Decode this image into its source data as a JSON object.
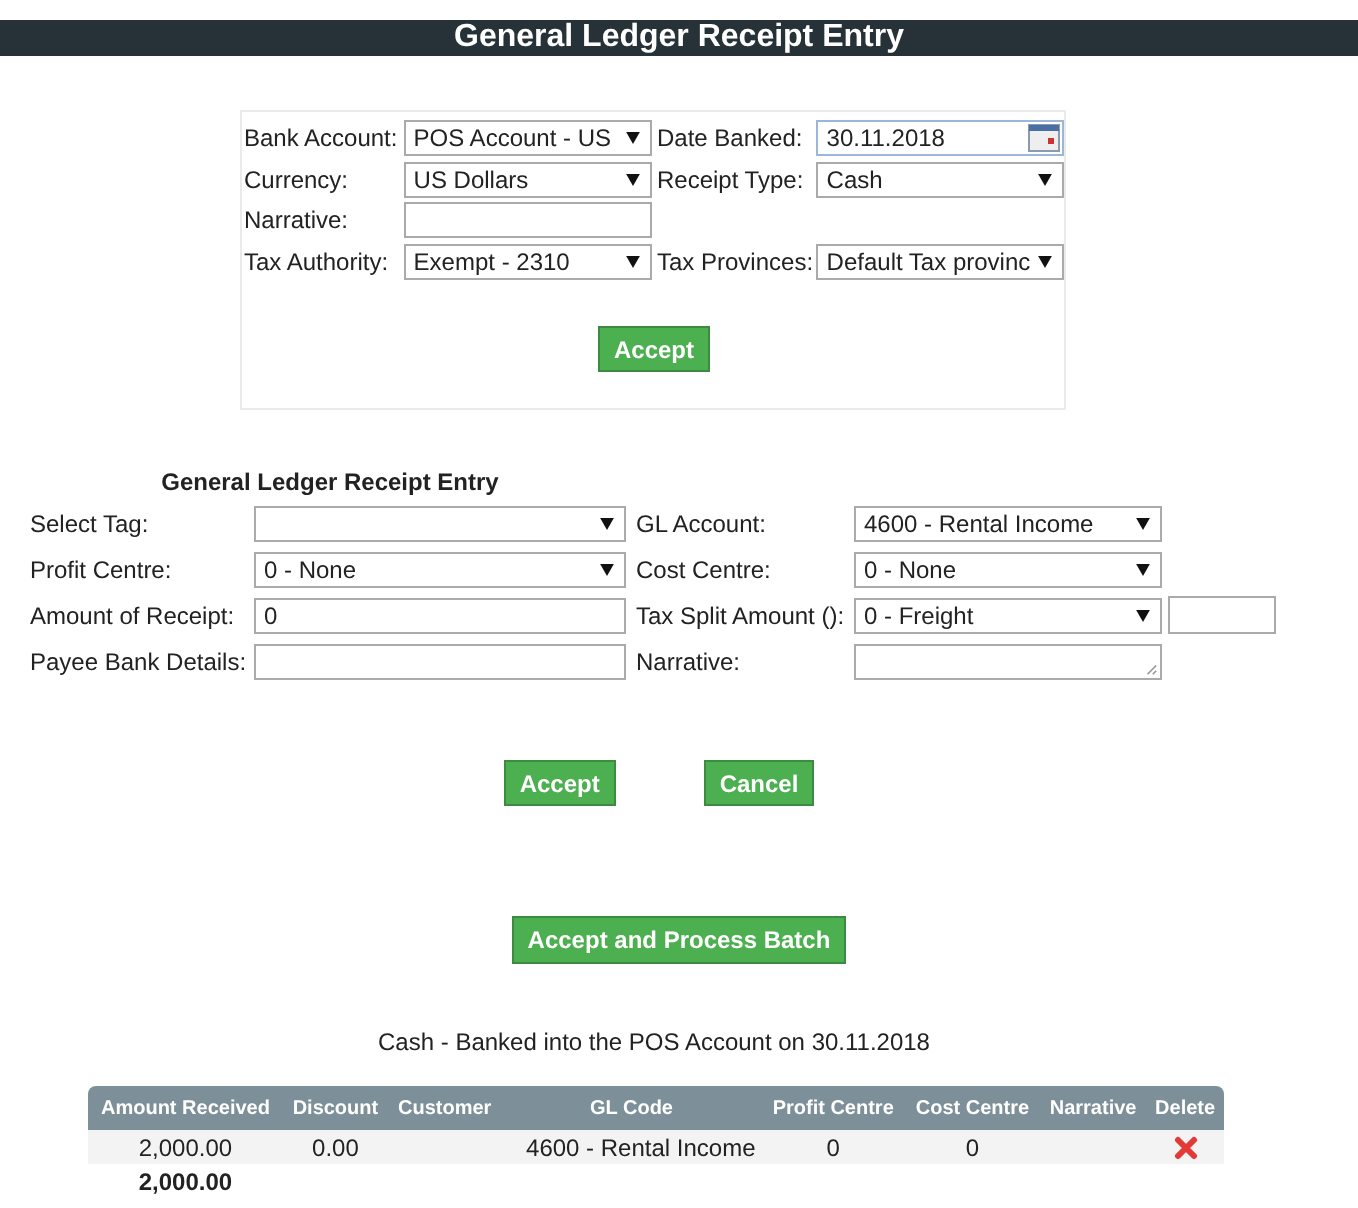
{
  "window": {
    "title": "General Ledger Receipt Entry"
  },
  "header_form": {
    "rows": [
      [
        {
          "label": "Bank Account:",
          "kind": "select",
          "value": "POS Account - US"
        },
        {
          "label": "Date Banked:",
          "kind": "date",
          "value": "30.11.2018"
        }
      ],
      [
        {
          "label": "Currency:",
          "kind": "select",
          "value": "US Dollars"
        },
        {
          "label": "Receipt Type:",
          "kind": "select",
          "value": "Cash"
        }
      ],
      [
        {
          "label": "Narrative:",
          "kind": "text"
        }
      ],
      [
        {
          "label": "Tax Authority:",
          "kind": "select",
          "value": "Exempt - 2310"
        },
        {
          "label": "Tax Provinces:",
          "kind": "select",
          "value": "Default Tax provinc"
        }
      ]
    ],
    "button": "Accept"
  },
  "entry_form": {
    "heading": "General Ledger Receipt Entry",
    "rows": [
      [
        {
          "label": "Select Tag:",
          "kind": "select"
        },
        {
          "label": "GL Account:",
          "kind": "select",
          "value": "4600 - Rental Income"
        }
      ],
      [
        {
          "label": "Profit Centre:",
          "kind": "select",
          "value": "0 - None"
        },
        {
          "label": "Cost Centre:",
          "kind": "select",
          "value": "0 - None"
        }
      ],
      [
        {
          "label": "Amount of Receipt:",
          "kind": "text",
          "value": "0"
        },
        {
          "label": "Tax Split Amount ():",
          "kind": "select_extra",
          "value": "0 - Freight"
        }
      ],
      [
        {
          "label": "Payee Bank Details:",
          "kind": "text"
        },
        {
          "label": "Narrative:",
          "kind": "textarea"
        }
      ]
    ],
    "buttons": [
      "Accept",
      "Cancel"
    ]
  },
  "process_button": "Accept and Process Batch",
  "batch": {
    "caption": "Cash - Banked into the POS Account on 30.11.2018",
    "columns": [
      "Amount Received",
      "Discount",
      "Customer",
      "GL Code",
      "Profit Centre",
      "Cost Centre",
      "Narrative",
      "Delete"
    ],
    "rows": [
      [
        "2,000.00",
        "0.00",
        "",
        "4600 - Rental Income",
        "0",
        "0",
        ""
      ]
    ],
    "total": "2,000.00"
  }
}
